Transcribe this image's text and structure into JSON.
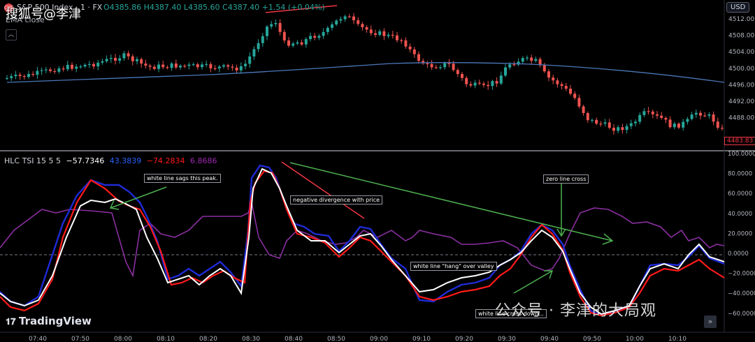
{
  "watermark_top": "搜狐号@李津",
  "watermark_wechat": "公众号 · 李津的大局观",
  "header": {
    "badge": "CME",
    "symbol": "S&P 500 Index · 1 · FX",
    "ohlc": "O4385.86  H4387.40  L4385.60  C4387.40  +1.54 (+0.04%)",
    "ema_label": "EMA close"
  },
  "currency": "USD",
  "brand": "TradingView",
  "price_axis": [
    "4512.00",
    "4508.00",
    "4504.00",
    "4500.00",
    "4496.00",
    "4492.00",
    "4488.00"
  ],
  "last_price": "4483.83",
  "indicator": {
    "name": "HLC TSI 15 5 5",
    "v1": "−57.7346",
    "v2": "43.3839",
    "v3": "−74.2834",
    "v4": "6.8686"
  },
  "ind_axis": [
    "100.0000",
    "80.0000",
    "60.0000",
    "40.0000",
    "20.0000",
    "0.0000",
    "−20.0000",
    "−40.0000",
    "−60.0000"
  ],
  "time_axis": [
    "07:40",
    "07:50",
    "08:00",
    "08:10",
    "08:20",
    "08:30",
    "08:40",
    "08:50",
    "09:00",
    "09:10",
    "09:20",
    "09:30",
    "09:40",
    "09:50",
    "10:00",
    "10:10"
  ],
  "annotations": {
    "a1": "white line sags this peak.",
    "a2": "negative divergence with price",
    "a3": "zero line cross",
    "a4": "white line \"hang\" over valley",
    "a5": "white line cross down..."
  },
  "colors": {
    "up": "#26a69a",
    "down": "#ef5350",
    "ema": "#4a78b8",
    "tsi_white": "#ffffff",
    "tsi_red": "#ff1a1a",
    "tsi_blue": "#1f2bd6",
    "tsi_purple": "#8a2fa0",
    "arrow_green": "#4caf50"
  }
}
